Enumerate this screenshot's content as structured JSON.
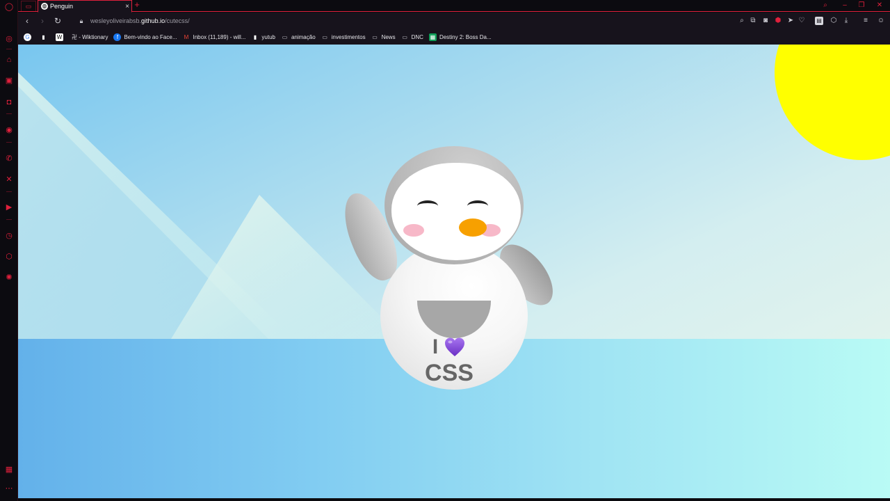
{
  "browser": {
    "tab": {
      "title": "Penguin",
      "close_glyph": "×",
      "new_tab_glyph": "+"
    },
    "address": {
      "url_prefix": "wesleyoliveirabsb.",
      "url_domain": "github.io",
      "url_path": "/cutecss/"
    },
    "bookmarks": [
      {
        "label": "",
        "icon": "google-icon",
        "icon_color": "#ffffff"
      },
      {
        "label": "",
        "icon": "document-icon",
        "icon_color": "#ffffff"
      },
      {
        "label": "",
        "icon": "wiktionary-square-icon",
        "icon_color": "#ffffff"
      },
      {
        "label": "卍 - Wiktionary",
        "icon": "none",
        "icon_color": ""
      },
      {
        "label": "Bem-vindo ao Face...",
        "icon": "facebook-icon",
        "icon_color": "#1877f2"
      },
      {
        "label": "Inbox (11,189) - will...",
        "icon": "gmail-icon",
        "icon_color": "#ea4335"
      },
      {
        "label": "yutub",
        "icon": "document-icon",
        "icon_color": "#ffffff"
      },
      {
        "label": "animação",
        "icon": "folder-icon",
        "icon_color": "#cfcfd6"
      },
      {
        "label": "investimentos",
        "icon": "folder-icon",
        "icon_color": "#cfcfd6"
      },
      {
        "label": "News",
        "icon": "folder-icon",
        "icon_color": "#cfcfd6"
      },
      {
        "label": "DNC",
        "icon": "folder-icon",
        "icon_color": "#cfcfd6"
      },
      {
        "label": "Destiny 2: Boss Da...",
        "icon": "sheets-icon",
        "icon_color": "#0f9d58"
      }
    ]
  },
  "page": {
    "shirt_line1": "I",
    "shirt_line2": "CSS"
  },
  "colors": {
    "accent": "#e0203c",
    "sun": "#ffff00",
    "beak": "#f7a000",
    "heart": "#8a4fd8"
  }
}
